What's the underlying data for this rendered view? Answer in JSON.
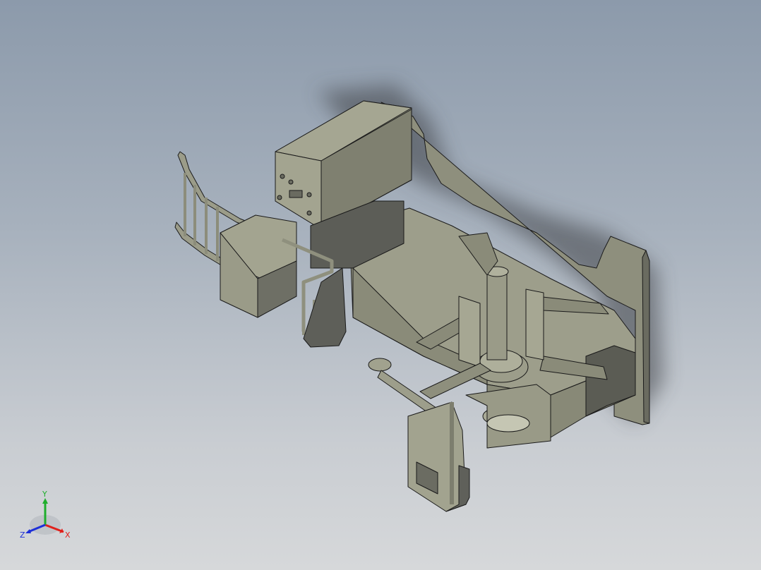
{
  "triad": {
    "x_label": "X",
    "y_label": "Y",
    "z_label": "Z",
    "x_color": "#e0201b",
    "y_color": "#1fae2c",
    "z_color": "#1d2fd8"
  },
  "model": {
    "shade_light": "#a2a38f",
    "shade_mid": "#8b8c7a",
    "shade_dark": "#5f605a",
    "edge_color": "#1a1a1a"
  }
}
